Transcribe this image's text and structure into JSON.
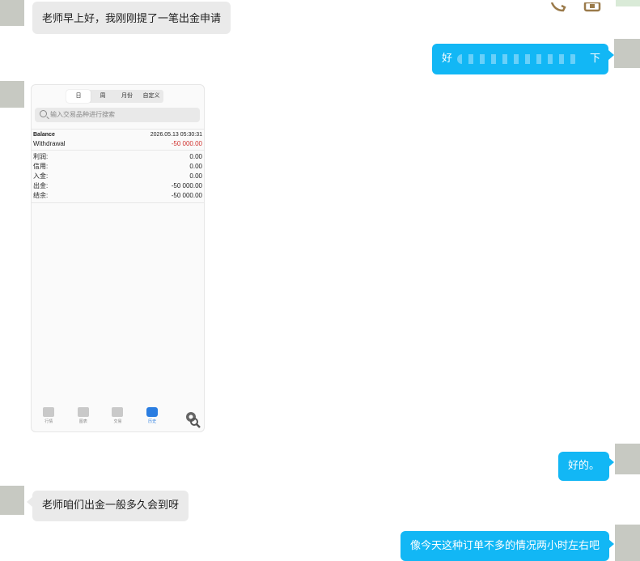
{
  "messages": {
    "m1_text": "老师早上好，我刚刚提了一笔出金申请",
    "m2_prefix": "好",
    "m2_suffix": "下",
    "m4_text": "好的。",
    "m5_text": "老师咱们出金一般多久会到呀",
    "m6_text": "像今天这种订单不多的情况两小时左右吧"
  },
  "phone": {
    "segments": [
      "日",
      "周",
      "月份",
      "自定义"
    ],
    "search_placeholder": "输入交易品种进行搜索",
    "balance_label": "Balance",
    "balance_date": "2026.05.13 05:30:31",
    "withdrawal_label": "Withdrawal",
    "withdrawal_value": "-50 000.00",
    "summary": [
      {
        "label": "利润:",
        "value": "0.00"
      },
      {
        "label": "信用:",
        "value": "0.00"
      },
      {
        "label": "入金:",
        "value": "0.00"
      },
      {
        "label": "出金:",
        "value": "-50 000.00"
      },
      {
        "label": "结余:",
        "value": "-50 000.00"
      }
    ],
    "tabs": [
      "行情",
      "图表",
      "交易",
      "历史",
      "设置"
    ]
  },
  "colors": {
    "sent_bubble": "#12b7f5",
    "received_bubble": "#eaeaea",
    "negative": "#d0312d",
    "tab_active": "#2a7de1"
  },
  "icons": [
    "phone-call-icon",
    "screen-share-icon",
    "search-icon",
    "settings-gear-icon"
  ]
}
